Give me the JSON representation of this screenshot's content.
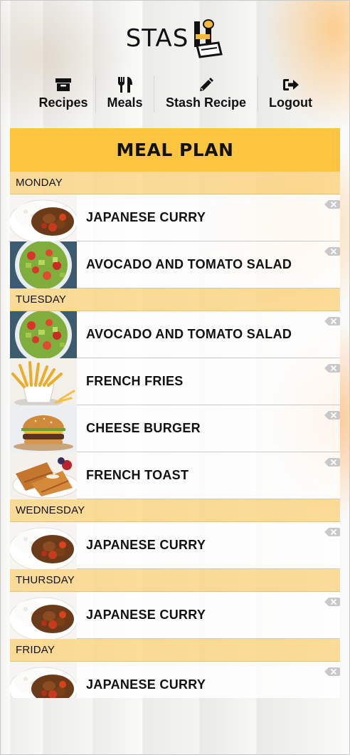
{
  "logo": {
    "text": "STAS"
  },
  "nav": {
    "items": [
      {
        "label": "Recipes",
        "icon": "archive-icon"
      },
      {
        "label": "Meals",
        "icon": "utensils-icon"
      },
      {
        "label": "Stash Recipe",
        "icon": "pencil-icon"
      },
      {
        "label": "Logout",
        "icon": "sign-out-icon"
      }
    ]
  },
  "meal_plan": {
    "title": "MEAL PLAN",
    "days": [
      {
        "day": "MONDAY",
        "meals": [
          {
            "name": "JAPANESE CURRY",
            "image": "japanese-curry"
          },
          {
            "name": "AVOCADO AND TOMATO SALAD",
            "image": "avocado-salad"
          }
        ]
      },
      {
        "day": "TUESDAY",
        "meals": [
          {
            "name": "AVOCADO AND TOMATO SALAD",
            "image": "avocado-salad"
          },
          {
            "name": "FRENCH FRIES",
            "image": "french-fries"
          },
          {
            "name": "CHEESE BURGER",
            "image": "cheese-burger"
          },
          {
            "name": "FRENCH TOAST",
            "image": "french-toast"
          }
        ]
      },
      {
        "day": "WEDNESDAY",
        "meals": [
          {
            "name": "JAPANESE CURRY",
            "image": "japanese-curry"
          }
        ]
      },
      {
        "day": "THURSDAY",
        "meals": [
          {
            "name": "JAPANESE CURRY",
            "image": "japanese-curry"
          }
        ]
      },
      {
        "day": "FRIDAY",
        "meals": [
          {
            "name": "JAPANESE CURRY",
            "image": "japanese-curry"
          }
        ]
      }
    ]
  },
  "colors": {
    "accent": "#fcc43f",
    "day_header": "#fcd47d"
  }
}
